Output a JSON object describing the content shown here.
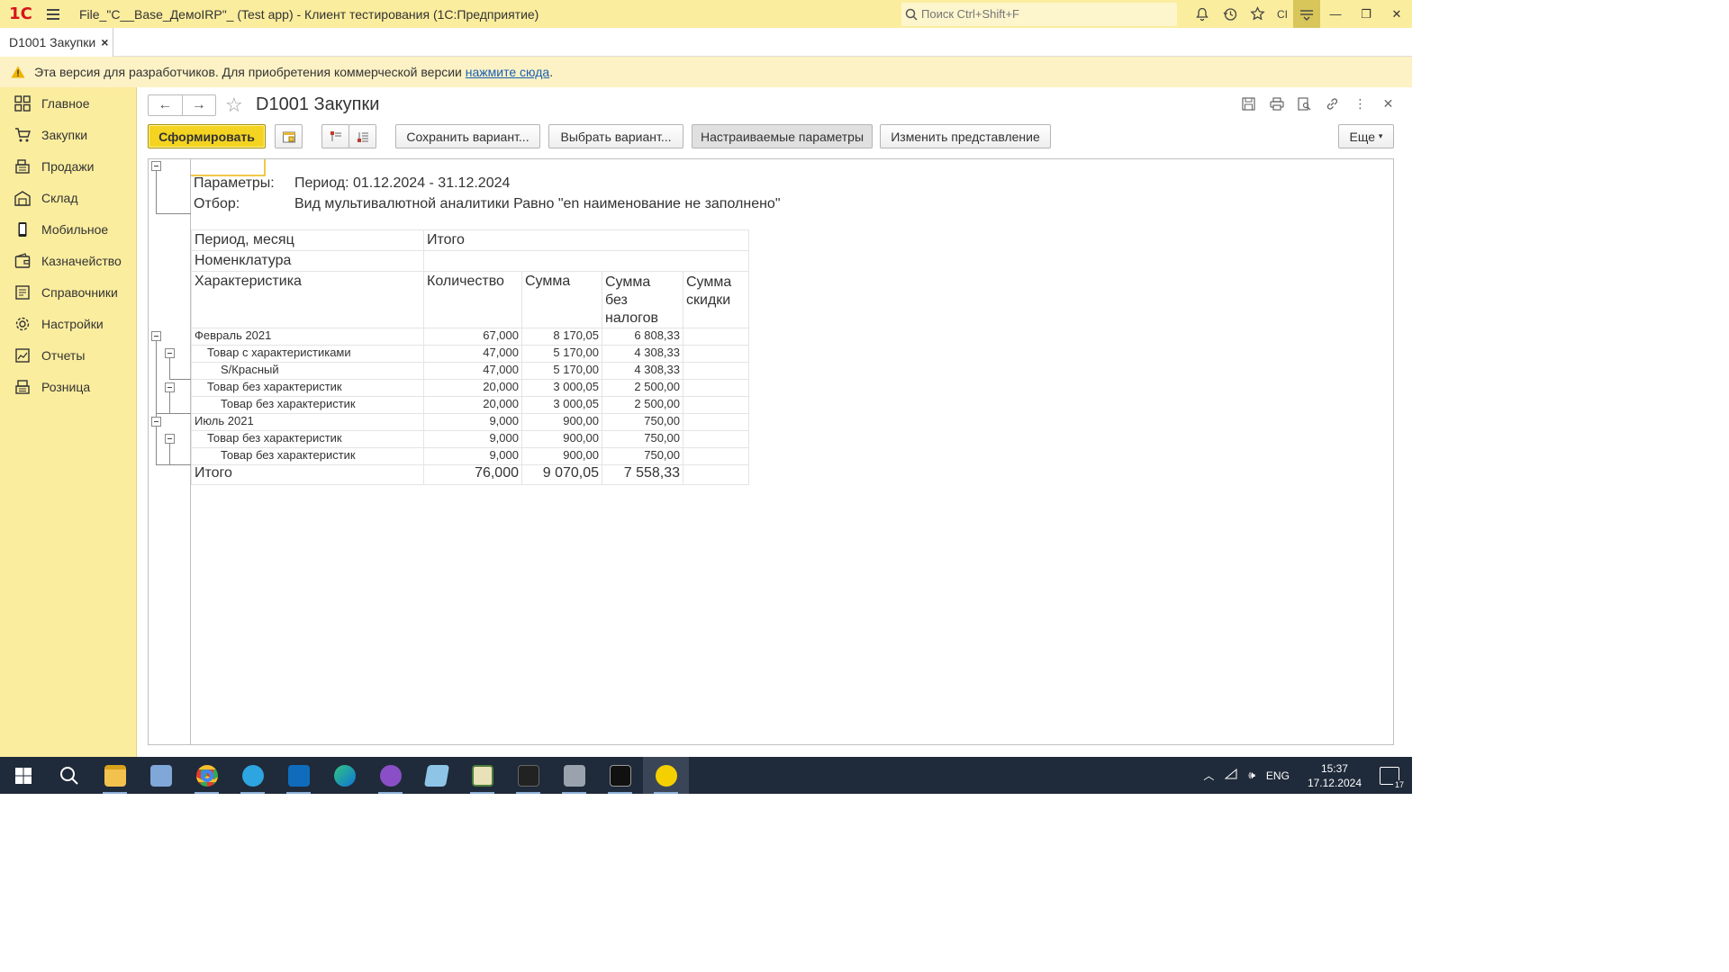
{
  "window": {
    "title": "File_\"C__Base_ДемоIRP\"_ (Test app) - Клиент тестирования (1С:Предприятие)",
    "search_placeholder": "Поиск Ctrl+Shift+F",
    "user_short": "CI"
  },
  "tabs": [
    {
      "label": "D1001 Закупки",
      "close": "×"
    }
  ],
  "notice": {
    "text": "Эта версия для разработчиков. Для приобретения коммерческой версии ",
    "link": "нажмите сюда",
    "tail": "."
  },
  "sidebar": {
    "items": [
      {
        "label": "Главное",
        "icon": "grid-icon"
      },
      {
        "label": "Закупки",
        "icon": "cart-icon"
      },
      {
        "label": "Продажи",
        "icon": "cash-register-icon"
      },
      {
        "label": "Склад",
        "icon": "warehouse-icon"
      },
      {
        "label": "Мобильное",
        "icon": "phone-icon"
      },
      {
        "label": "Казначейство",
        "icon": "wallet-icon"
      },
      {
        "label": "Справочники",
        "icon": "book-icon"
      },
      {
        "label": "Настройки",
        "icon": "gear-icon"
      },
      {
        "label": "Отчеты",
        "icon": "chart-icon"
      },
      {
        "label": "Розница",
        "icon": "shop-icon"
      }
    ]
  },
  "page": {
    "title": "D1001 Закупки"
  },
  "commands": {
    "generate": "Сформировать",
    "save_variant": "Сохранить вариант...",
    "choose_variant": "Выбрать вариант...",
    "custom_params": "Настраиваемые параметры",
    "change_view": "Изменить представление",
    "more": "Еще"
  },
  "report": {
    "params_label": "Параметры:",
    "params_value": "Период: 01.12.2024 - 31.12.2024",
    "filter_label": "Отбор:",
    "filter_value": "Вид мультивалютной аналитики Равно \"en наименование не заполнено\"",
    "header": {
      "period": "Период, месяц",
      "itogo": "Итого",
      "nomenclature": "Номенклатура",
      "characteristic": "Характеристика",
      "qty": "Количество",
      "sum": "Сумма",
      "sum_no_tax": "Сумма без налогов",
      "sum_no_tax_l1": "Сумма",
      "sum_no_tax_l2": "без",
      "sum_no_tax_l3": "налогов",
      "sum_discount_l1": "Сумма",
      "sum_discount_l2": "скидки"
    },
    "rows": [
      {
        "name": "Февраль 2021",
        "qty": "67,000",
        "sum": "8 170,05",
        "net": "6 808,33",
        "disc": ""
      },
      {
        "name": "Товар с характеристиками",
        "qty": "47,000",
        "sum": "5 170,00",
        "net": "4 308,33",
        "disc": ""
      },
      {
        "name": "S/Красный",
        "qty": "47,000",
        "sum": "5 170,00",
        "net": "4 308,33",
        "disc": ""
      },
      {
        "name": "Товар без характеристик",
        "qty": "20,000",
        "sum": "3 000,05",
        "net": "2 500,00",
        "disc": ""
      },
      {
        "name": "Товар без характеристик",
        "qty": "20,000",
        "sum": "3 000,05",
        "net": "2 500,00",
        "disc": ""
      },
      {
        "name": "Июль 2021",
        "qty": "9,000",
        "sum": "900,00",
        "net": "750,00",
        "disc": ""
      },
      {
        "name": "Товар без характеристик",
        "qty": "9,000",
        "sum": "900,00",
        "net": "750,00",
        "disc": ""
      },
      {
        "name": "Товар без характеристик",
        "qty": "9,000",
        "sum": "900,00",
        "net": "750,00",
        "disc": ""
      }
    ],
    "total": {
      "name": "Итого",
      "qty": "76,000",
      "sum": "9 070,05",
      "net": "7 558,33",
      "disc": ""
    }
  },
  "taskbar": {
    "lang": "ENG",
    "time": "15:37",
    "date": "17.12.2024",
    "notifications": "17"
  }
}
